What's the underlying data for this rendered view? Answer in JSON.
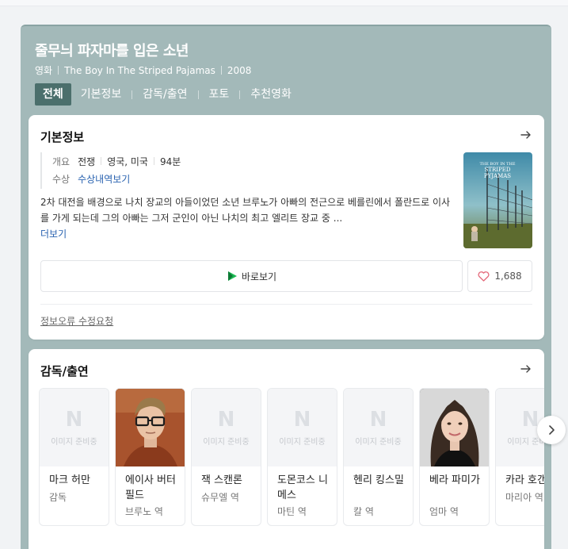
{
  "movie": {
    "title": "줄무늬 파자마를 입은 소년",
    "category": "영화",
    "original_title": "The Boy In The Striped Pajamas",
    "year": "2008"
  },
  "tabs": [
    {
      "label": "전체",
      "active": true
    },
    {
      "label": "기본정보",
      "active": false
    },
    {
      "label": "감독/출연",
      "active": false
    },
    {
      "label": "포토",
      "active": false
    },
    {
      "label": "추천영화",
      "active": false
    }
  ],
  "basic_info": {
    "title": "기본정보",
    "overview_label": "개요",
    "genre": "전쟁",
    "country": "영국, 미국",
    "runtime": "94분",
    "award_label": "수상",
    "award_link": "수상내역보기",
    "synopsis": "2차 대전을 배경으로 나치 장교의 아들이었던 소년 브루노가 아빠의 전근으로 베를린에서 폴란드로 이사를 가게 되는데 그의 아빠는 그저 군인이 아닌 나치의 최고 엘리트 장교 중 ...",
    "more_label": "더보기",
    "watch_label": "바로보기",
    "likes": "1,688",
    "report_label": "정보오류 수정요청"
  },
  "poster": {
    "text_line1": "THE BOY IN THE",
    "text_line2": "STRIPED",
    "text_line3": "PYJAMAS"
  },
  "cast_section": {
    "title": "감독/출연",
    "placeholder_text": "이미지 준비중",
    "people": [
      {
        "name": "마크 허만",
        "role": "감독",
        "photo": "placeholder"
      },
      {
        "name": "에이사 버터필드",
        "role": "브루노 역",
        "photo": "asa"
      },
      {
        "name": "잭 스캔론",
        "role": "슈무엘 역",
        "photo": "placeholder"
      },
      {
        "name": "도몬코스 니메스",
        "role": "마틴 역",
        "photo": "placeholder"
      },
      {
        "name": "헨리 킹스밀",
        "role": "칼 역",
        "photo": "placeholder"
      },
      {
        "name": "베라 파미가",
        "role": "엄마 역",
        "photo": "vera"
      },
      {
        "name": "카라 호갠",
        "role": "마리아 역",
        "photo": "placeholder"
      }
    ]
  },
  "colors": {
    "header_bg": "#a3b9b9",
    "active_tab": "#4b6f6c",
    "link": "#2962b0",
    "play_icon": "#1db954"
  }
}
